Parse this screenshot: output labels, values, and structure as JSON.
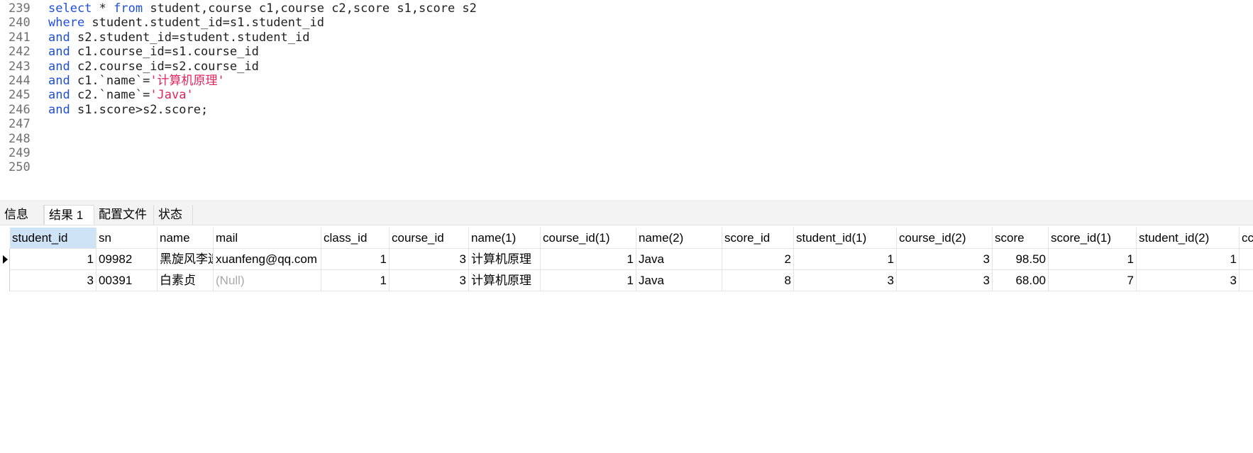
{
  "editor": {
    "lines": [
      {
        "no": "239",
        "tokens": [
          {
            "t": "select",
            "c": "kw"
          },
          {
            "t": " * ",
            "c": ""
          },
          {
            "t": "from",
            "c": "kw"
          },
          {
            "t": " student,course c1,course c2,score s1,score s2",
            "c": ""
          }
        ]
      },
      {
        "no": "240",
        "tokens": [
          {
            "t": "where",
            "c": "kw"
          },
          {
            "t": " student.student_id=s1.student_id",
            "c": ""
          }
        ]
      },
      {
        "no": "241",
        "tokens": [
          {
            "t": "and",
            "c": "kw"
          },
          {
            "t": " s2.student_id=student.student_id",
            "c": ""
          }
        ]
      },
      {
        "no": "242",
        "tokens": [
          {
            "t": "and",
            "c": "kw"
          },
          {
            "t": " c1.course_id=s1.course_id",
            "c": ""
          }
        ]
      },
      {
        "no": "243",
        "tokens": [
          {
            "t": "and",
            "c": "kw"
          },
          {
            "t": " c2.course_id=s2.course_id",
            "c": ""
          }
        ]
      },
      {
        "no": "244",
        "tokens": [
          {
            "t": "and",
            "c": "kw"
          },
          {
            "t": " c1.`name`=",
            "c": ""
          },
          {
            "t": "'计算机原理'",
            "c": "str"
          }
        ]
      },
      {
        "no": "245",
        "tokens": [
          {
            "t": "and",
            "c": "kw"
          },
          {
            "t": " c2.`name`=",
            "c": ""
          },
          {
            "t": "'Java'",
            "c": "str"
          }
        ]
      },
      {
        "no": "246",
        "tokens": [
          {
            "t": "and",
            "c": "kw"
          },
          {
            "t": " s1.score>s2.score;",
            "c": ""
          }
        ]
      },
      {
        "no": "247",
        "tokens": []
      },
      {
        "no": "248",
        "tokens": []
      },
      {
        "no": "249",
        "tokens": []
      },
      {
        "no": "250",
        "tokens": []
      }
    ]
  },
  "tabs": [
    {
      "label": "信息",
      "active": false
    },
    {
      "label": "结果 1",
      "active": true
    },
    {
      "label": "配置文件",
      "active": false
    },
    {
      "label": "状态",
      "active": false
    }
  ],
  "grid": {
    "columns": [
      "student_id",
      "sn",
      "name",
      "mail",
      "class_id",
      "course_id",
      "name(1)",
      "course_id(1)",
      "name(2)",
      "score_id",
      "student_id(1)",
      "course_id(2)",
      "score",
      "score_id(1)",
      "student_id(2)",
      "cc"
    ],
    "numeric": [
      true,
      false,
      false,
      false,
      true,
      true,
      false,
      true,
      false,
      true,
      true,
      true,
      true,
      true,
      true,
      false
    ],
    "rows": [
      [
        "1",
        "09982",
        "黑旋风李逵",
        "xuanfeng@qq.com",
        "1",
        "3",
        "计算机原理",
        "1",
        "Java",
        "2",
        "1",
        "3",
        "98.50",
        "1",
        "1",
        ""
      ],
      [
        "3",
        "00391",
        "白素贞",
        "(Null)",
        "1",
        "3",
        "计算机原理",
        "1",
        "Java",
        "8",
        "3",
        "3",
        "68.00",
        "7",
        "3",
        ""
      ]
    ],
    "null_text": "(Null)"
  },
  "colors": {
    "keyword": "#1e4fd8",
    "string": "#e0245e",
    "selected_header": "#cfe3f7",
    "null": "#a9a9a9"
  }
}
